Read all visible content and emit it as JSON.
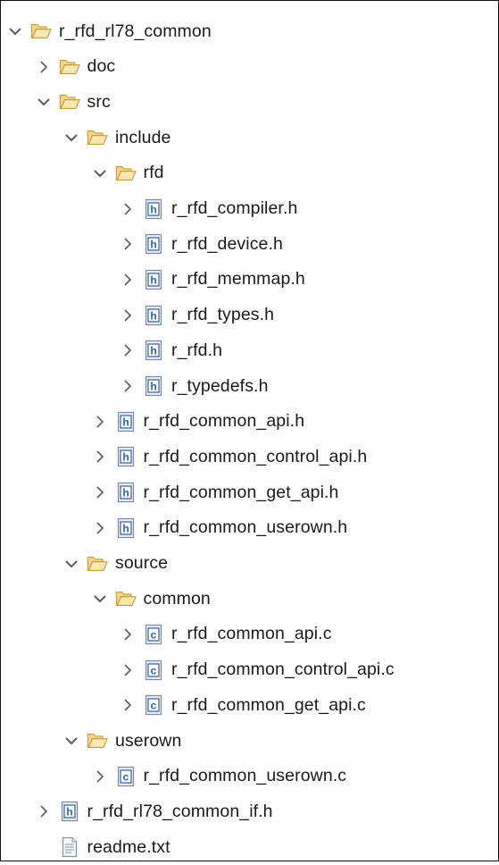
{
  "project_tree": [
    {
      "label": "r_rfd_rl78_common",
      "depth": 0,
      "type": "folder",
      "state": "expanded"
    },
    {
      "label": "doc",
      "depth": 1,
      "type": "folder",
      "state": "collapsed"
    },
    {
      "label": "src",
      "depth": 1,
      "type": "folder",
      "state": "expanded"
    },
    {
      "label": "include",
      "depth": 2,
      "type": "folder",
      "state": "expanded"
    },
    {
      "label": "rfd",
      "depth": 3,
      "type": "folder",
      "state": "expanded"
    },
    {
      "label": "r_rfd_compiler.h",
      "depth": 4,
      "type": "h-file",
      "state": "collapsed"
    },
    {
      "label": "r_rfd_device.h",
      "depth": 4,
      "type": "h-file",
      "state": "collapsed"
    },
    {
      "label": "r_rfd_memmap.h",
      "depth": 4,
      "type": "h-file",
      "state": "collapsed"
    },
    {
      "label": "r_rfd_types.h",
      "depth": 4,
      "type": "h-file",
      "state": "collapsed"
    },
    {
      "label": "r_rfd.h",
      "depth": 4,
      "type": "h-file",
      "state": "collapsed"
    },
    {
      "label": "r_typedefs.h",
      "depth": 4,
      "type": "h-file",
      "state": "collapsed"
    },
    {
      "label": "r_rfd_common_api.h",
      "depth": 3,
      "type": "h-file",
      "state": "collapsed"
    },
    {
      "label": "r_rfd_common_control_api.h",
      "depth": 3,
      "type": "h-file",
      "state": "collapsed"
    },
    {
      "label": "r_rfd_common_get_api.h",
      "depth": 3,
      "type": "h-file",
      "state": "collapsed"
    },
    {
      "label": "r_rfd_common_userown.h",
      "depth": 3,
      "type": "h-file",
      "state": "collapsed"
    },
    {
      "label": "source",
      "depth": 2,
      "type": "folder",
      "state": "expanded"
    },
    {
      "label": "common",
      "depth": 3,
      "type": "folder",
      "state": "expanded"
    },
    {
      "label": "r_rfd_common_api.c",
      "depth": 4,
      "type": "c-file",
      "state": "collapsed"
    },
    {
      "label": "r_rfd_common_control_api.c",
      "depth": 4,
      "type": "c-file",
      "state": "collapsed"
    },
    {
      "label": "r_rfd_common_get_api.c",
      "depth": 4,
      "type": "c-file",
      "state": "collapsed"
    },
    {
      "label": "userown",
      "depth": 2,
      "type": "folder",
      "state": "expanded"
    },
    {
      "label": "r_rfd_common_userown.c",
      "depth": 3,
      "type": "c-file",
      "state": "collapsed"
    },
    {
      "label": "r_rfd_rl78_common_if.h",
      "depth": 1,
      "type": "h-file",
      "state": "collapsed"
    },
    {
      "label": "readme.txt",
      "depth": 1,
      "type": "txt-file",
      "state": "none"
    }
  ],
  "icons": {
    "folder": "folder-open-icon",
    "h-file": "c-header-file-icon",
    "c-file": "c-source-file-icon",
    "txt-file": "text-file-icon",
    "expanded": "chevron-down-icon",
    "collapsed": "chevron-right-icon"
  },
  "colors": {
    "folder_fill": "#f3d58e",
    "folder_stroke": "#c89b3a",
    "file_badge_blue": "#2f5fa7",
    "chevron": "#5a5a5a",
    "text": "#1a1a1a"
  }
}
